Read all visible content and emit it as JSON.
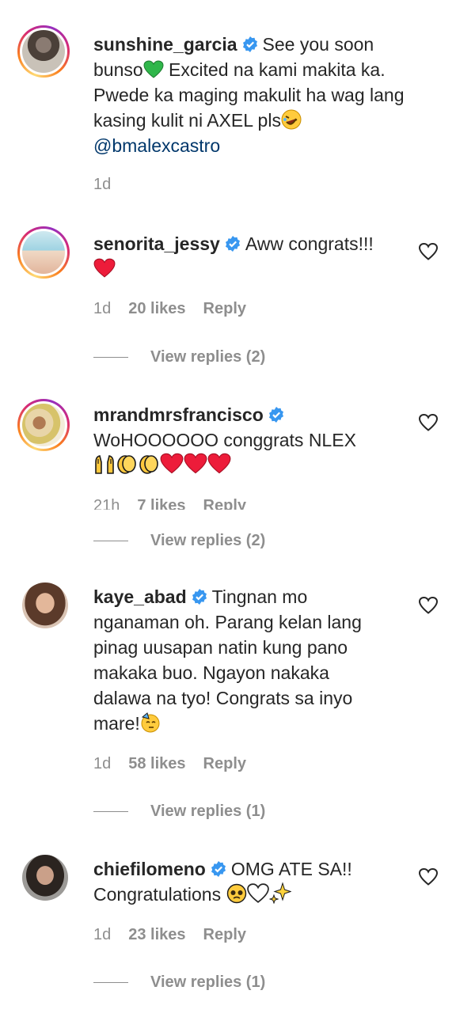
{
  "comments": [
    {
      "username": "sunshine_garcia",
      "text_lines": [
        "See you soon",
        "bunso",
        " Excited na kami makita ka.",
        "Pwede ka maging makulit ha wag lang",
        "kasing kulit ni AXEL pls"
      ],
      "mention": "@bmalexcastro",
      "time": "1d",
      "likes": "",
      "reply_label": "",
      "view_replies": ""
    },
    {
      "username": "senorita_jessy",
      "text": "Aww congrats!!!",
      "time": "1d",
      "likes": "20 likes",
      "reply_label": "Reply",
      "view_replies": "View replies (2)"
    },
    {
      "username": "mrandmrsfrancisco",
      "text": "WoHOOOOOO conggrats NLEX",
      "time": "21h",
      "likes": "7 likes",
      "reply_label": "Reply",
      "view_replies": "View replies (2)"
    },
    {
      "username": "kaye_abad",
      "text_lines": [
        "Tingnan mo",
        "nganaman oh. Parang kelan lang",
        "pinag uusapan natin kung pano",
        "makaka buo. Ngayon nakaka",
        "dalawa na tyo! Congrats sa inyo",
        "mare!"
      ],
      "time": "1d",
      "likes": "58 likes",
      "reply_label": "Reply",
      "view_replies": "View replies (1)"
    },
    {
      "username": "chiefilomeno",
      "text_lines": [
        "OMG ATE SA!!",
        "Congratulations"
      ],
      "time": "1d",
      "likes": "23 likes",
      "reply_label": "Reply",
      "view_replies": "View replies (1)"
    }
  ],
  "icons": {
    "verified": "verified-badge-icon",
    "like": "heart-outline-icon"
  },
  "colors": {
    "text": "#262626",
    "muted": "#8e8e8e",
    "mention": "#00376b",
    "verified": "#3897f0",
    "heart_red": "#ed1c3a"
  }
}
